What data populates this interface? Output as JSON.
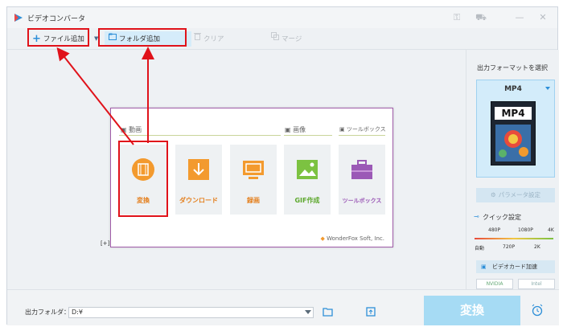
{
  "app": {
    "title": "ビデオコンバータ"
  },
  "toolbar": {
    "add_file": "ファイル追加",
    "add_folder": "フォルダ追加",
    "clear": "クリア",
    "merge": "マージ"
  },
  "launcher": {
    "sections": {
      "video": "動画",
      "image": "画像",
      "toolbox": "ツールボックス"
    },
    "tiles": [
      {
        "label": "変換",
        "icon": "film-convert-icon",
        "color": "#f39a2e"
      },
      {
        "label": "ダウンロード",
        "icon": "download-icon",
        "color": "#f39a2e"
      },
      {
        "label": "録画",
        "icon": "screen-record-icon",
        "color": "#f39a2e"
      },
      {
        "label": "GIF作成",
        "icon": "gif-image-icon",
        "color": "#7cc241"
      },
      {
        "label": "ツールボックス",
        "icon": "toolbox-icon",
        "color": "#9b59b6"
      }
    ],
    "brand": "WonderFox Soft, Inc."
  },
  "side_text": "[+]",
  "right_panel": {
    "title": "出力フォーマットを選択",
    "format": "MP4",
    "format_thumbnail_text": "MP4",
    "param_button": "パラメータ設定",
    "quick_label": "クイック設定",
    "quality_top": [
      "480P",
      "1080P",
      "4K"
    ],
    "quality_bottom": [
      "自動",
      "720P",
      "2K"
    ],
    "gpu_button": "ビデオカード加速",
    "gpu_badges": [
      "NVIDIA",
      "Intel"
    ]
  },
  "bottom": {
    "output_label": "出力フォルダ：",
    "output_path": "D:¥",
    "convert": "変換"
  },
  "colors": {
    "accent_red": "#e0121a",
    "convert_bg": "#a6dbf4",
    "launcher_border": "#a05ca8"
  }
}
